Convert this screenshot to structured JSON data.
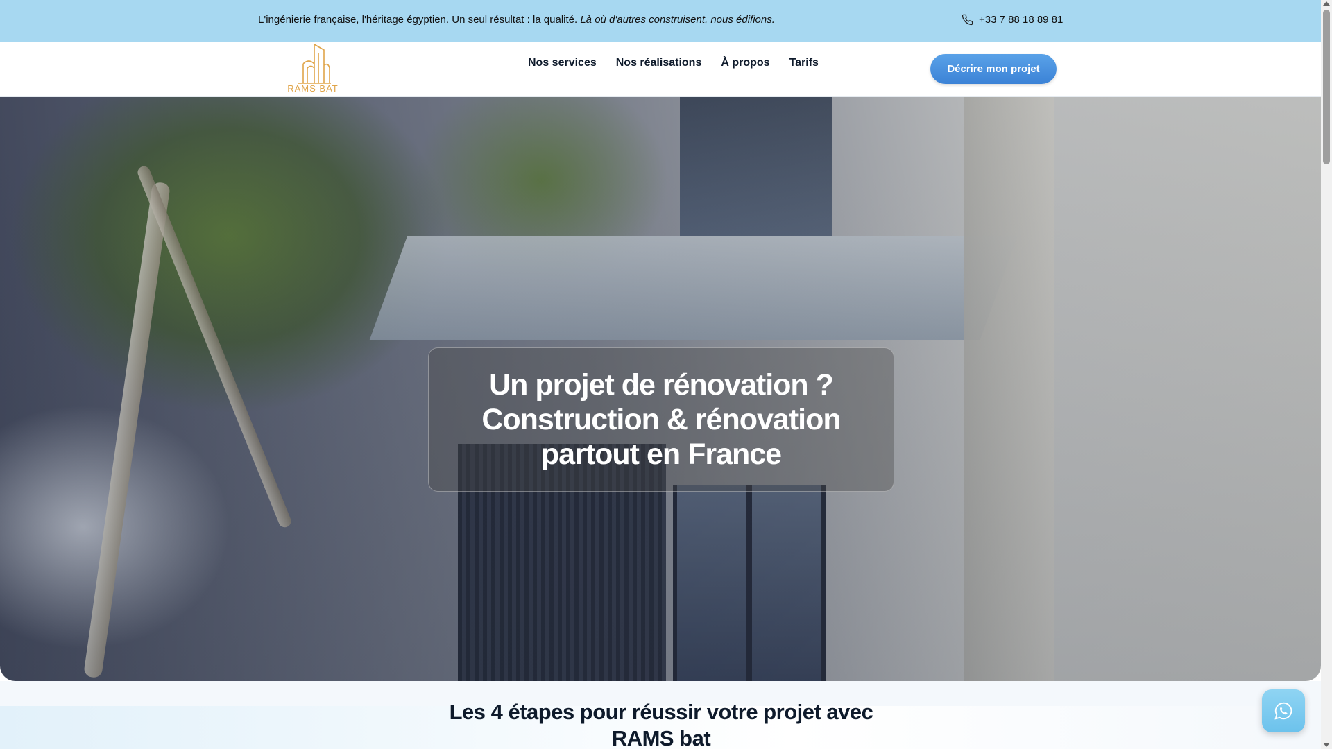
{
  "topbar": {
    "tagline": "L'ingénierie française, l'héritage égyptien. Un seul résultat : la qualité.",
    "tagline_italic": "Là où d'autres construisent, nous édifions.",
    "phone": "+33 7 88 18 89 81"
  },
  "header": {
    "logo_text": "RAMS BAT",
    "nav": [
      "Nos services",
      "Nos réalisations",
      "À propos",
      "Tarifs"
    ],
    "cta_label": "Décrire mon projet"
  },
  "hero": {
    "title": "Un projet de rénovation ? Construction & rénovation partout en France"
  },
  "steps": {
    "title": "Les 4 étapes pour réussir votre projet avec RAMS bat"
  },
  "colors": {
    "topbar_bg": "#a7d8f1",
    "cta_bg": "#3b82d6",
    "logo_gold": "#e0a54a",
    "whatsapp_bg": "#7ccbef"
  },
  "icons": {
    "phone": "phone-icon",
    "whatsapp": "whatsapp-icon",
    "logo": "building-logo-icon"
  }
}
